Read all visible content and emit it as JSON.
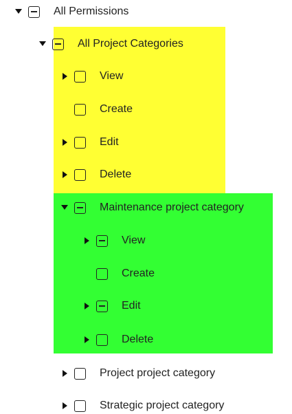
{
  "tree": {
    "root": {
      "label": "All Permissions",
      "state": "indeterminate",
      "expanded": true
    },
    "all_categories": {
      "label": "All Project Categories",
      "state": "indeterminate",
      "expanded": true,
      "children": [
        {
          "label": "View",
          "state": "unchecked",
          "has_children": true
        },
        {
          "label": "Create",
          "state": "unchecked",
          "has_children": false
        },
        {
          "label": "Edit",
          "state": "unchecked",
          "has_children": true
        },
        {
          "label": "Delete",
          "state": "unchecked",
          "has_children": true
        }
      ]
    },
    "maintenance": {
      "label": "Maintenance project category",
      "state": "indeterminate",
      "expanded": true,
      "children": [
        {
          "label": "View",
          "state": "indeterminate",
          "has_children": true
        },
        {
          "label": "Create",
          "state": "unchecked",
          "has_children": false
        },
        {
          "label": "Edit",
          "state": "indeterminate",
          "has_children": true
        },
        {
          "label": "Delete",
          "state": "unchecked",
          "has_children": true
        }
      ]
    },
    "project_category": {
      "label": "Project project category",
      "state": "unchecked",
      "expanded": false
    },
    "strategic_category": {
      "label": "Strategic project category",
      "state": "unchecked",
      "expanded": false
    }
  },
  "highlights": {
    "yellow": "#ffff33",
    "green": "#33ff33"
  }
}
